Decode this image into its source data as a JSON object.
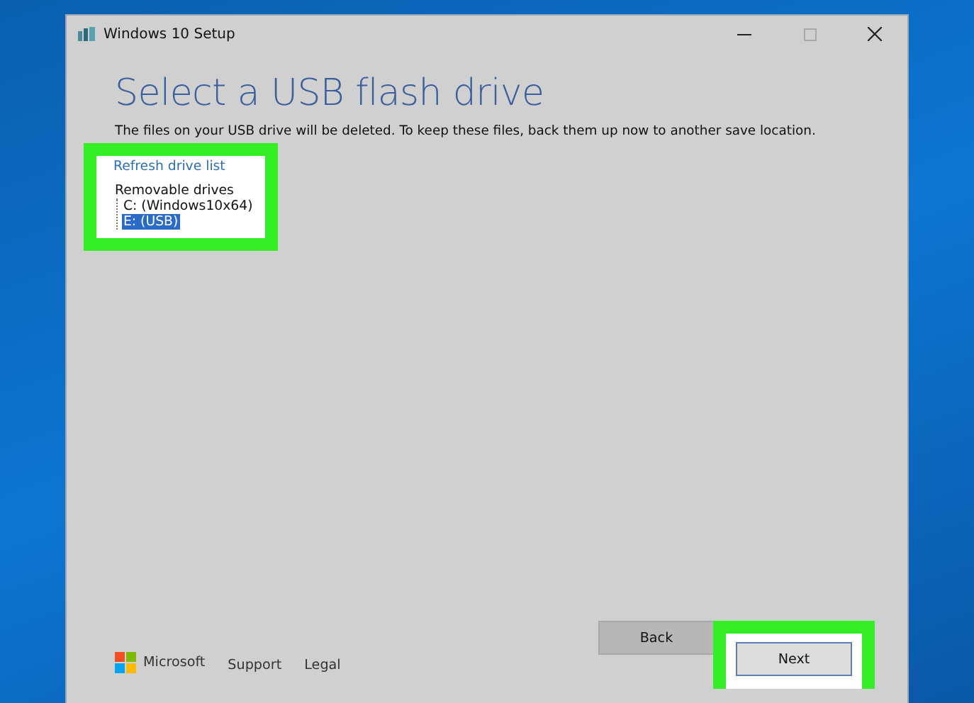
{
  "window": {
    "title": "Windows 10 Setup"
  },
  "heading": "Select a USB flash drive",
  "description": "The files on your USB drive will be deleted. To keep these files, back them up now to another save location.",
  "refresh_link": "Refresh drive list",
  "drives": [
    {
      "label": "Removable drives",
      "selected": false,
      "children": [
        {
          "label": "C: (Windows10x64)",
          "selected": false
        },
        {
          "label": "E: (USB)",
          "selected": true
        }
      ]
    }
  ],
  "footer": {
    "brand": "Microsoft",
    "links": [
      "Support",
      "Legal"
    ]
  },
  "buttons": [
    {
      "label": "Back",
      "kind": "secondary",
      "highlighted": false
    },
    {
      "label": "Next",
      "kind": "primary",
      "highlighted": true
    }
  ]
}
